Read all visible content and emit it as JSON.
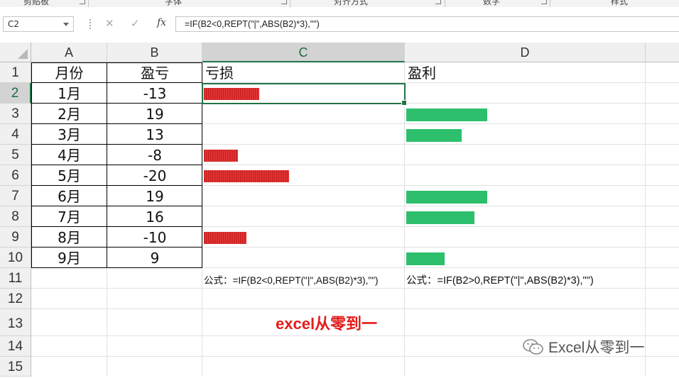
{
  "ribbon": {
    "groups": [
      "剪贴板",
      "字体",
      "对齐方式",
      "数字",
      "样式"
    ]
  },
  "formula_bar": {
    "name_box": "C2",
    "cancel_icon": "✕",
    "enter_icon": "✓",
    "fx_label": "fx",
    "formula": "=IF(B2<0,REPT(\"|\",ABS(B2)*3),\"\")"
  },
  "columns": [
    "A",
    "B",
    "C",
    "D"
  ],
  "rows": [
    "1",
    "2",
    "3",
    "4",
    "5",
    "6",
    "7",
    "8",
    "9",
    "10",
    "11",
    "12",
    "13",
    "14",
    "15"
  ],
  "headers": {
    "month": "月份",
    "pnl": "盈亏",
    "loss": "亏损",
    "profit": "盈利"
  },
  "table": [
    {
      "month": "1月",
      "value": "-13"
    },
    {
      "month": "2月",
      "value": "19"
    },
    {
      "month": "3月",
      "value": "13"
    },
    {
      "month": "4月",
      "value": "-8"
    },
    {
      "month": "5月",
      "value": "-20"
    },
    {
      "month": "6月",
      "value": "19"
    },
    {
      "month": "7月",
      "value": "16"
    },
    {
      "month": "8月",
      "value": "-10"
    },
    {
      "month": "9月",
      "value": "9"
    }
  ],
  "bar_values": [
    -13,
    19,
    13,
    -8,
    -20,
    19,
    16,
    -10,
    9
  ],
  "notes": {
    "loss_formula": "公式：=IF(B2<0,REPT(\"|\",ABS(B2)*3),\"\")",
    "profit_formula": "公式：=IF(B2>0,REPT(\"|\",ABS(B2)*3),\"\")",
    "banner": "excel从零到一",
    "watermark": "Excel从零到一"
  },
  "colors": {
    "loss": "#e02b2b",
    "profit": "#2dbf6c",
    "accent": "#217346",
    "banner": "#e41c1c"
  }
}
